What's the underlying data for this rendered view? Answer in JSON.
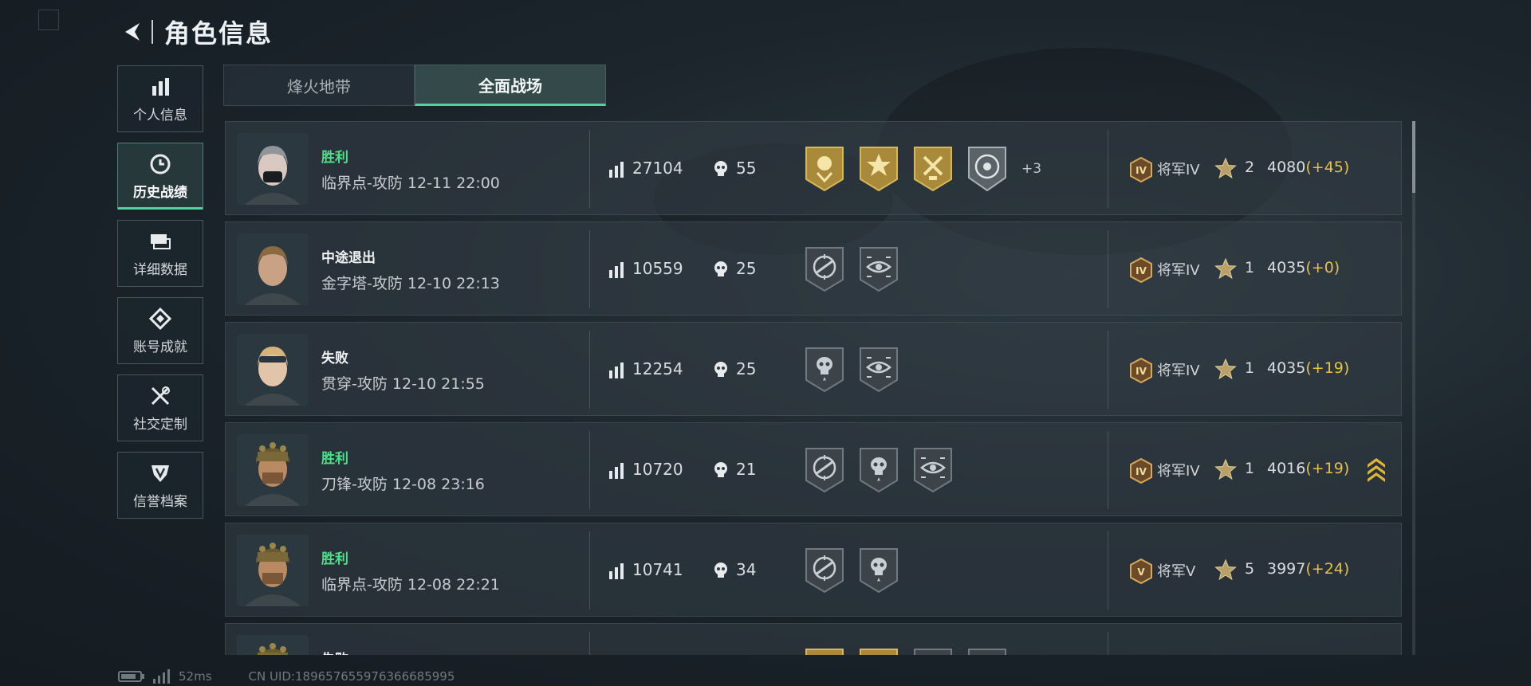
{
  "header": {
    "title": "角色信息"
  },
  "side_nav": [
    {
      "label": "个人信息",
      "icon": "bar-chart-icon",
      "active": false
    },
    {
      "label": "历史战绩",
      "icon": "clock-icon",
      "active": true
    },
    {
      "label": "详细数据",
      "icon": "layers-icon",
      "active": false
    },
    {
      "label": "账号成就",
      "icon": "diamond-badge-icon",
      "active": false
    },
    {
      "label": "社交定制",
      "icon": "wrench-screwdriver-icon",
      "active": false
    },
    {
      "label": "信誉档案",
      "icon": "shield-emblem-icon",
      "active": false
    }
  ],
  "tabs": [
    {
      "label": "烽火地带",
      "active": false
    },
    {
      "label": "全面战场",
      "active": true
    }
  ],
  "matches": [
    {
      "result": "胜利",
      "result_type": "win",
      "map_time": "临界点-攻防 12-11 22:00",
      "score": "27104",
      "kills": "55",
      "badges": [
        "gold-rose-badge",
        "gold-burst-badge",
        "gold-hammer-badge",
        "silver-skull-target-badge"
      ],
      "badges_more": "+3",
      "rank": "将军IV",
      "rank_emblem": "IV",
      "stars": "2",
      "points": "4080",
      "delta": "(+45)",
      "rank_change": false
    },
    {
      "result": "中途退出",
      "result_type": "other",
      "map_time": "金字塔-攻防 12-10 22:13",
      "score": "10559",
      "kills": "25",
      "badges": [
        "gray-crosshair-rifle-badge",
        "gray-eye-target-badge"
      ],
      "badges_more": "",
      "rank": "将军IV",
      "rank_emblem": "IV",
      "stars": "1",
      "points": "4035",
      "delta": "(+0)",
      "rank_change": false
    },
    {
      "result": "失败",
      "result_type": "other",
      "map_time": "贯穿-攻防 12-10 21:55",
      "score": "12254",
      "kills": "25",
      "badges": [
        "gray-skull-star-badge",
        "gray-eye-target-badge"
      ],
      "badges_more": "",
      "rank": "将军IV",
      "rank_emblem": "IV",
      "stars": "1",
      "points": "4035",
      "delta": "(+19)",
      "rank_change": false
    },
    {
      "result": "胜利",
      "result_type": "win",
      "map_time": "刀锋-攻防 12-08 23:16",
      "score": "10720",
      "kills": "21",
      "badges": [
        "gray-crosshair-rifle-badge",
        "gray-skull-star-badge",
        "gray-eye-target-badge"
      ],
      "badges_more": "",
      "rank": "将军IV",
      "rank_emblem": "IV",
      "stars": "1",
      "points": "4016",
      "delta": "(+19)",
      "rank_change": true
    },
    {
      "result": "胜利",
      "result_type": "win",
      "map_time": "临界点-攻防 12-08 22:21",
      "score": "10741",
      "kills": "34",
      "badges": [
        "gray-crosshair-rifle-badge",
        "gray-skull-star-badge"
      ],
      "badges_more": "",
      "rank": "将军V",
      "rank_emblem": "V",
      "stars": "5",
      "points": "3997",
      "delta": "(+24)",
      "rank_change": false
    },
    {
      "result": "失败",
      "result_type": "other",
      "map_time": "",
      "score": "",
      "kills": "",
      "badges": [
        "gold-rose-badge",
        "gold-burst-badge",
        "gray-skull-star-badge",
        "gray-eye-target-badge"
      ],
      "badges_more": "",
      "rank": "",
      "rank_emblem": "",
      "stars": "",
      "points": "",
      "delta": "",
      "rank_change": false
    }
  ],
  "footer": {
    "ping": "52ms",
    "uid": "CN UID:1896576559763666859​95"
  },
  "colors": {
    "accent": "#4fd6a0",
    "win": "#4fe08a",
    "delta": "#e3c14f",
    "gold_badge": "#b8973f"
  }
}
